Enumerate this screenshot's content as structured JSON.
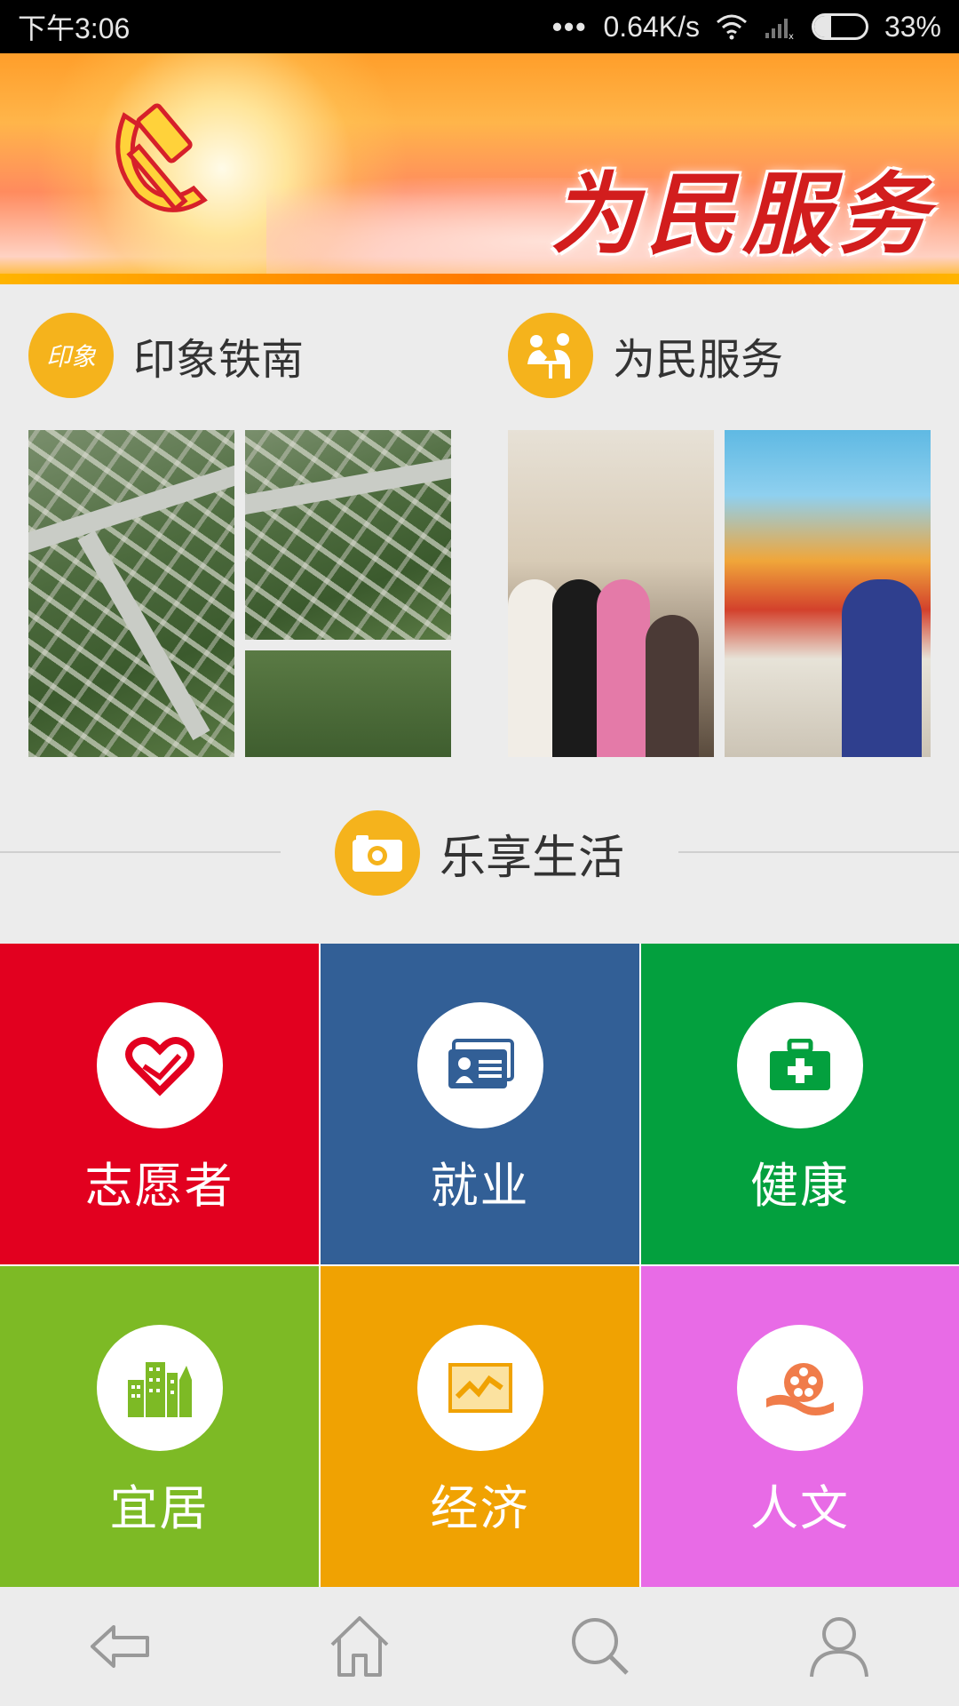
{
  "status_bar": {
    "time": "下午3:06",
    "network_speed": "0.64K/s",
    "battery_percent": "33%",
    "battery_level": 0.33
  },
  "banner": {
    "title": "为民服务",
    "emblem_icon": "party-emblem-icon"
  },
  "features": [
    {
      "title": "印象铁南",
      "icon": "yinxiang-logo-icon",
      "icon_text": "印象"
    },
    {
      "title": "为民服务",
      "icon": "service-people-icon"
    }
  ],
  "section": {
    "title": "乐享生活",
    "icon": "camera-icon"
  },
  "tiles": [
    {
      "label": "志愿者",
      "icon": "heart-hand-icon",
      "color": "#e2001f"
    },
    {
      "label": "就业",
      "icon": "id-card-icon",
      "color": "#325f96"
    },
    {
      "label": "健康",
      "icon": "medical-kit-icon",
      "color": "#03a03e"
    },
    {
      "label": "宜居",
      "icon": "buildings-icon",
      "color": "#7dba25"
    },
    {
      "label": "经济",
      "icon": "chart-trend-icon",
      "color": "#f0a202"
    },
    {
      "label": "人文",
      "icon": "film-reel-icon",
      "color": "#e86be6"
    }
  ],
  "bottom_nav": [
    {
      "icon": "back-icon"
    },
    {
      "icon": "home-icon"
    },
    {
      "icon": "search-icon"
    },
    {
      "icon": "user-icon"
    }
  ],
  "colors": {
    "accent": "#f5b31c",
    "banner_title": "#d21d1d"
  }
}
